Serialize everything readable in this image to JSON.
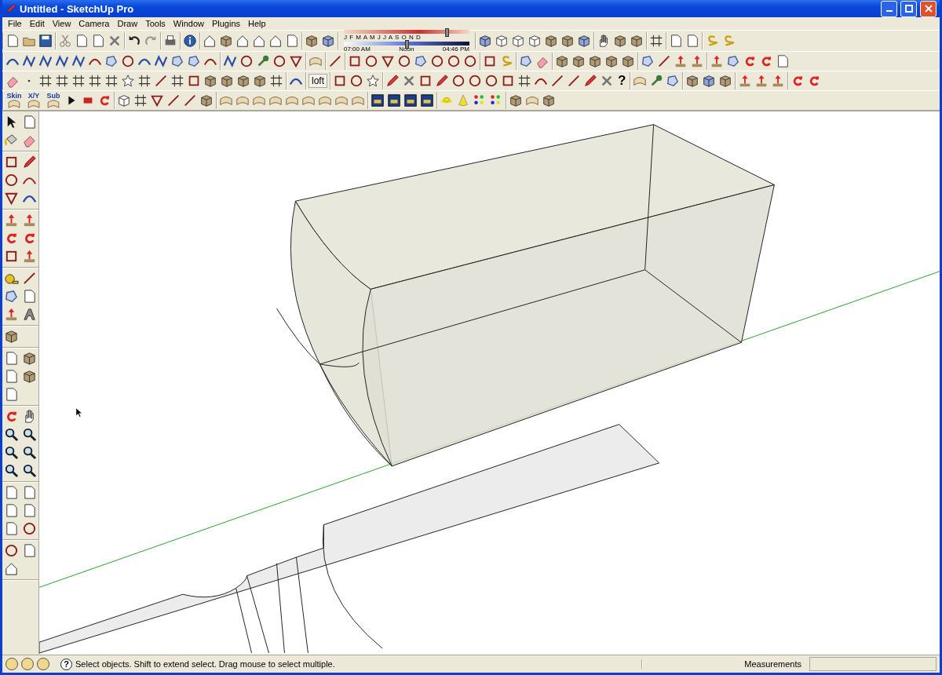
{
  "window": {
    "title": "Untitled - SketchUp Pro"
  },
  "menu": [
    "File",
    "Edit",
    "View",
    "Camera",
    "Draw",
    "Tools",
    "Window",
    "Plugins",
    "Help"
  ],
  "toolbars": {
    "sandbox_labels": [
      "Skin",
      "X/Y",
      "Sub"
    ],
    "loft_label": "loft",
    "help_glyph": "?"
  },
  "shadows": {
    "months": "J F M A M J J A S O N D",
    "date_slider": {
      "level": 0.82
    },
    "times": [
      "07:00 AM",
      "Noon",
      "04:46 PM"
    ],
    "time_slider": {
      "level": 0.5
    }
  },
  "status_bar": {
    "help_glyph": "?",
    "hint": "Select objects. Shift to extend select. Drag mouse to select multiple.",
    "measurements_label": "Measurements"
  }
}
